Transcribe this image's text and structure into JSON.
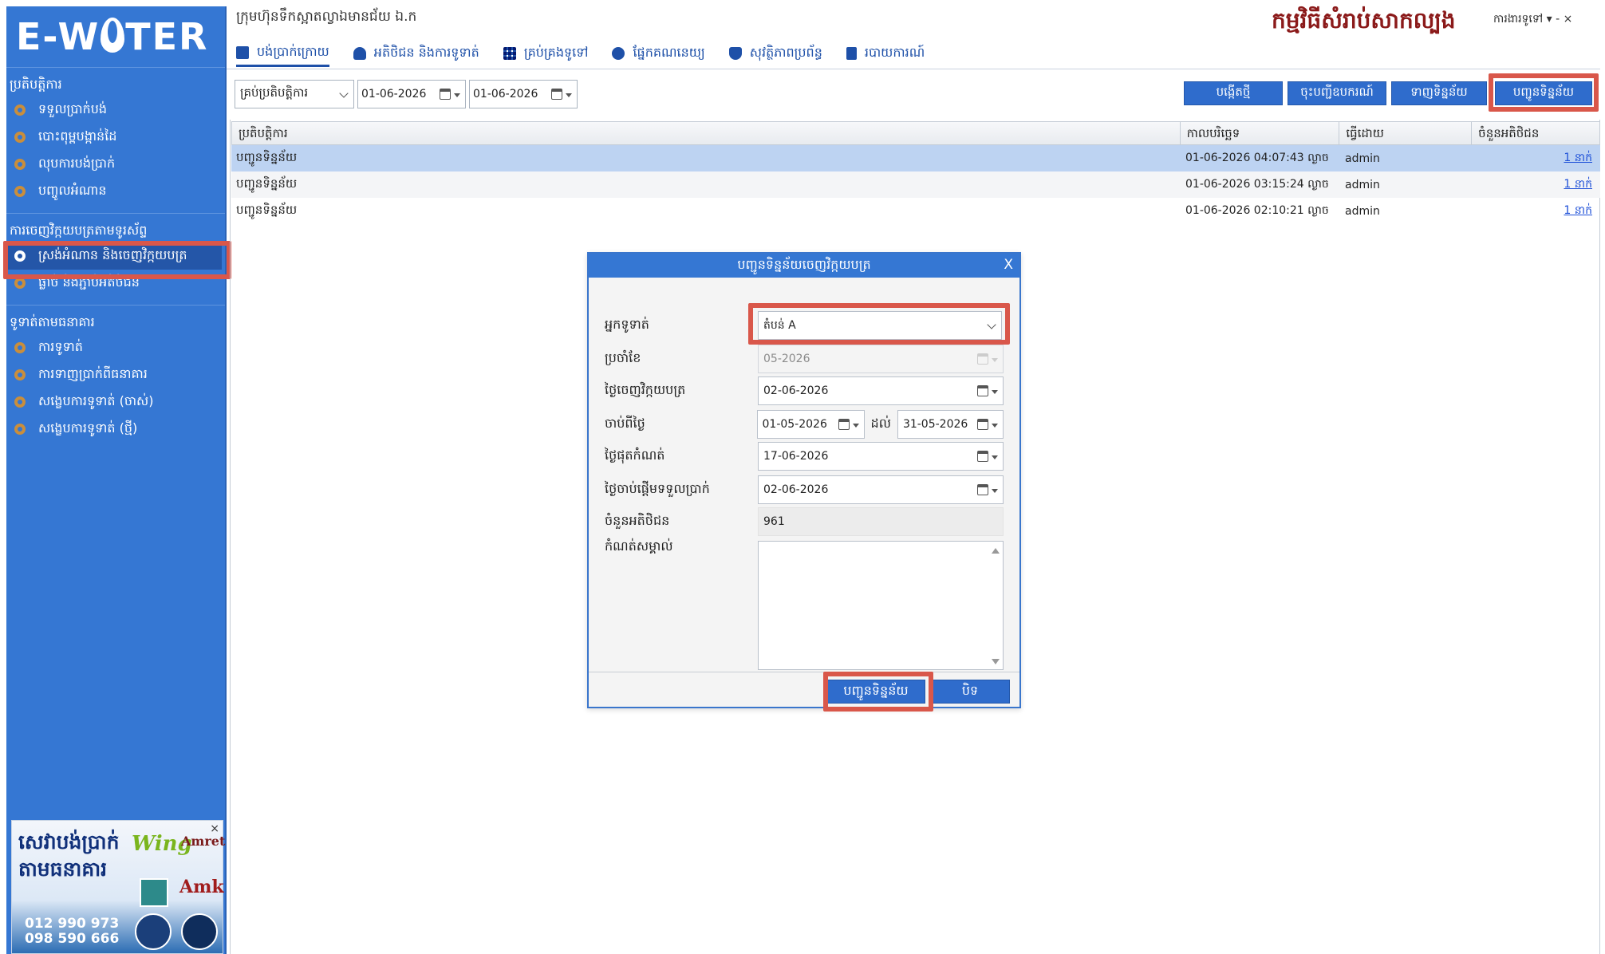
{
  "app": {
    "logo": "E-WATER",
    "company": "ក្រុមហ៊ុនទឹកស្អាតល្វាឯមានជ័យ ឯ.ក",
    "title": "កម្មវិធីសំរាប់សាកល្បង",
    "user_menu": "ការងារទូទៅ ▾  -  ×"
  },
  "nav": {
    "tabs": [
      {
        "label": "បង់ប្រាក់ក្រោយ",
        "icon": "card-icon"
      },
      {
        "label": "អតិថិជន និងការទូទាត់",
        "icon": "users-icon"
      },
      {
        "label": "គ្រប់គ្រងទូទៅ",
        "icon": "grid-icon"
      },
      {
        "label": "ផ្នែកគណនេយ្យ",
        "icon": "globe-icon"
      },
      {
        "label": "សុវត្ថិភាពប្រព័ន្ធ",
        "icon": "shield-icon"
      },
      {
        "label": "របាយការណ៍",
        "icon": "document-icon"
      }
    ]
  },
  "sidebar": {
    "sections": [
      {
        "heading": "ប្រតិបត្តិការ",
        "items": [
          "ទទួលប្រាក់បង់",
          "បោះពុម្ពបង្កាន់ដៃ",
          "លុបការបង់ប្រាក់",
          "បញ្ចូលអំណាន"
        ]
      },
      {
        "heading": "ការចេញវិក្កយបត្រតាមទូរស័ព្ទ",
        "items": [
          "ស្រង់អំណាន និងចេញវិក្កយបត្រ",
          "ផ្លាច់ និងភ្ជាប់អតិថិជន"
        ]
      },
      {
        "heading": "ទូទាត់តាមធនាគារ",
        "items": [
          "ការទូទាត់",
          "ការទាញប្រាក់ពីធនាគារ",
          "សង្ខេបការទូទាត់ (ចាស់)",
          "សង្ខេបការទូទាត់ (ថ្មី)"
        ]
      }
    ],
    "active_item": "ស្រង់អំណាន និងចេញវិក្កយបត្រ"
  },
  "ad": {
    "headline": "សេវាបង់ប្រាក់ តាមធនាគារ",
    "phone1": "012 990 973",
    "phone2": "098 590 666",
    "brand1": "Wing",
    "brand2": "Amret",
    "brand3": "Amk",
    "close": "×"
  },
  "toolbar": {
    "filter_select": "គ្រប់ប្រតិបត្តិការ",
    "date_from": "01-06-2026",
    "date_to": "01-06-2026",
    "buttons": [
      "បង្កើតថ្មី",
      "ចុះបញ្ជីឧបករណ៍",
      "ទាញទិន្នន័យ",
      "បញ្ជូនទិន្នន័យ"
    ]
  },
  "table": {
    "headers": [
      "ប្រតិបត្តិការ",
      "កាលបរិច្ឆេទ",
      "ធ្វើដោយ",
      "ចំនួនអតិថិជន"
    ],
    "rows": [
      [
        "បញ្ជូនទិន្នន័យ",
        "01-06-2026 04:07:43 ល្ងាច",
        "admin",
        "1 នាក់"
      ],
      [
        "បញ្ជូនទិន្នន័យ",
        "01-06-2026 03:15:24 ល្ងាច",
        "admin",
        "1 នាក់"
      ],
      [
        "បញ្ជូនទិន្នន័យ",
        "01-06-2026 02:10:21 ល្ងាច",
        "admin",
        "1 នាក់"
      ]
    ]
  },
  "dialog": {
    "title": "បញ្ជូនទិន្នន័យចេញវិក្កយបត្រ",
    "close": "X",
    "fields": {
      "collector_label": "អ្នកទូទាត់",
      "collector_value": "តំបន់ A",
      "month_label": "ប្រចាំខែ",
      "month_value": "05-2026",
      "bill_date_label": "ថ្ងៃចេញវិក្កយបត្រ",
      "bill_date_value": "02-06-2026",
      "from_label": "ចាប់ពីថ្ងៃ",
      "from_value": "01-05-2026",
      "to_label": "ដល់",
      "to_value": "31-05-2026",
      "due_label": "ថ្ងៃផុតកំណត់",
      "due_value": "17-06-2026",
      "start_pay_label": "ថ្ងៃចាប់ផ្តើមទទួលប្រាក់",
      "start_pay_value": "02-06-2026",
      "customer_count_label": "ចំនួនអតិថិជន",
      "customer_count_value": "961",
      "note_label": "កំណត់សម្គាល់"
    },
    "send_button": "បញ្ជូនទិន្នន័យ",
    "close_button": "បិទ"
  },
  "colors": {
    "sidebar": "#3577d3",
    "accent": "#2f6ccc",
    "highlight": "#d9574a",
    "title": "#8b1a1a",
    "selected_row": "#bdd3f2"
  }
}
